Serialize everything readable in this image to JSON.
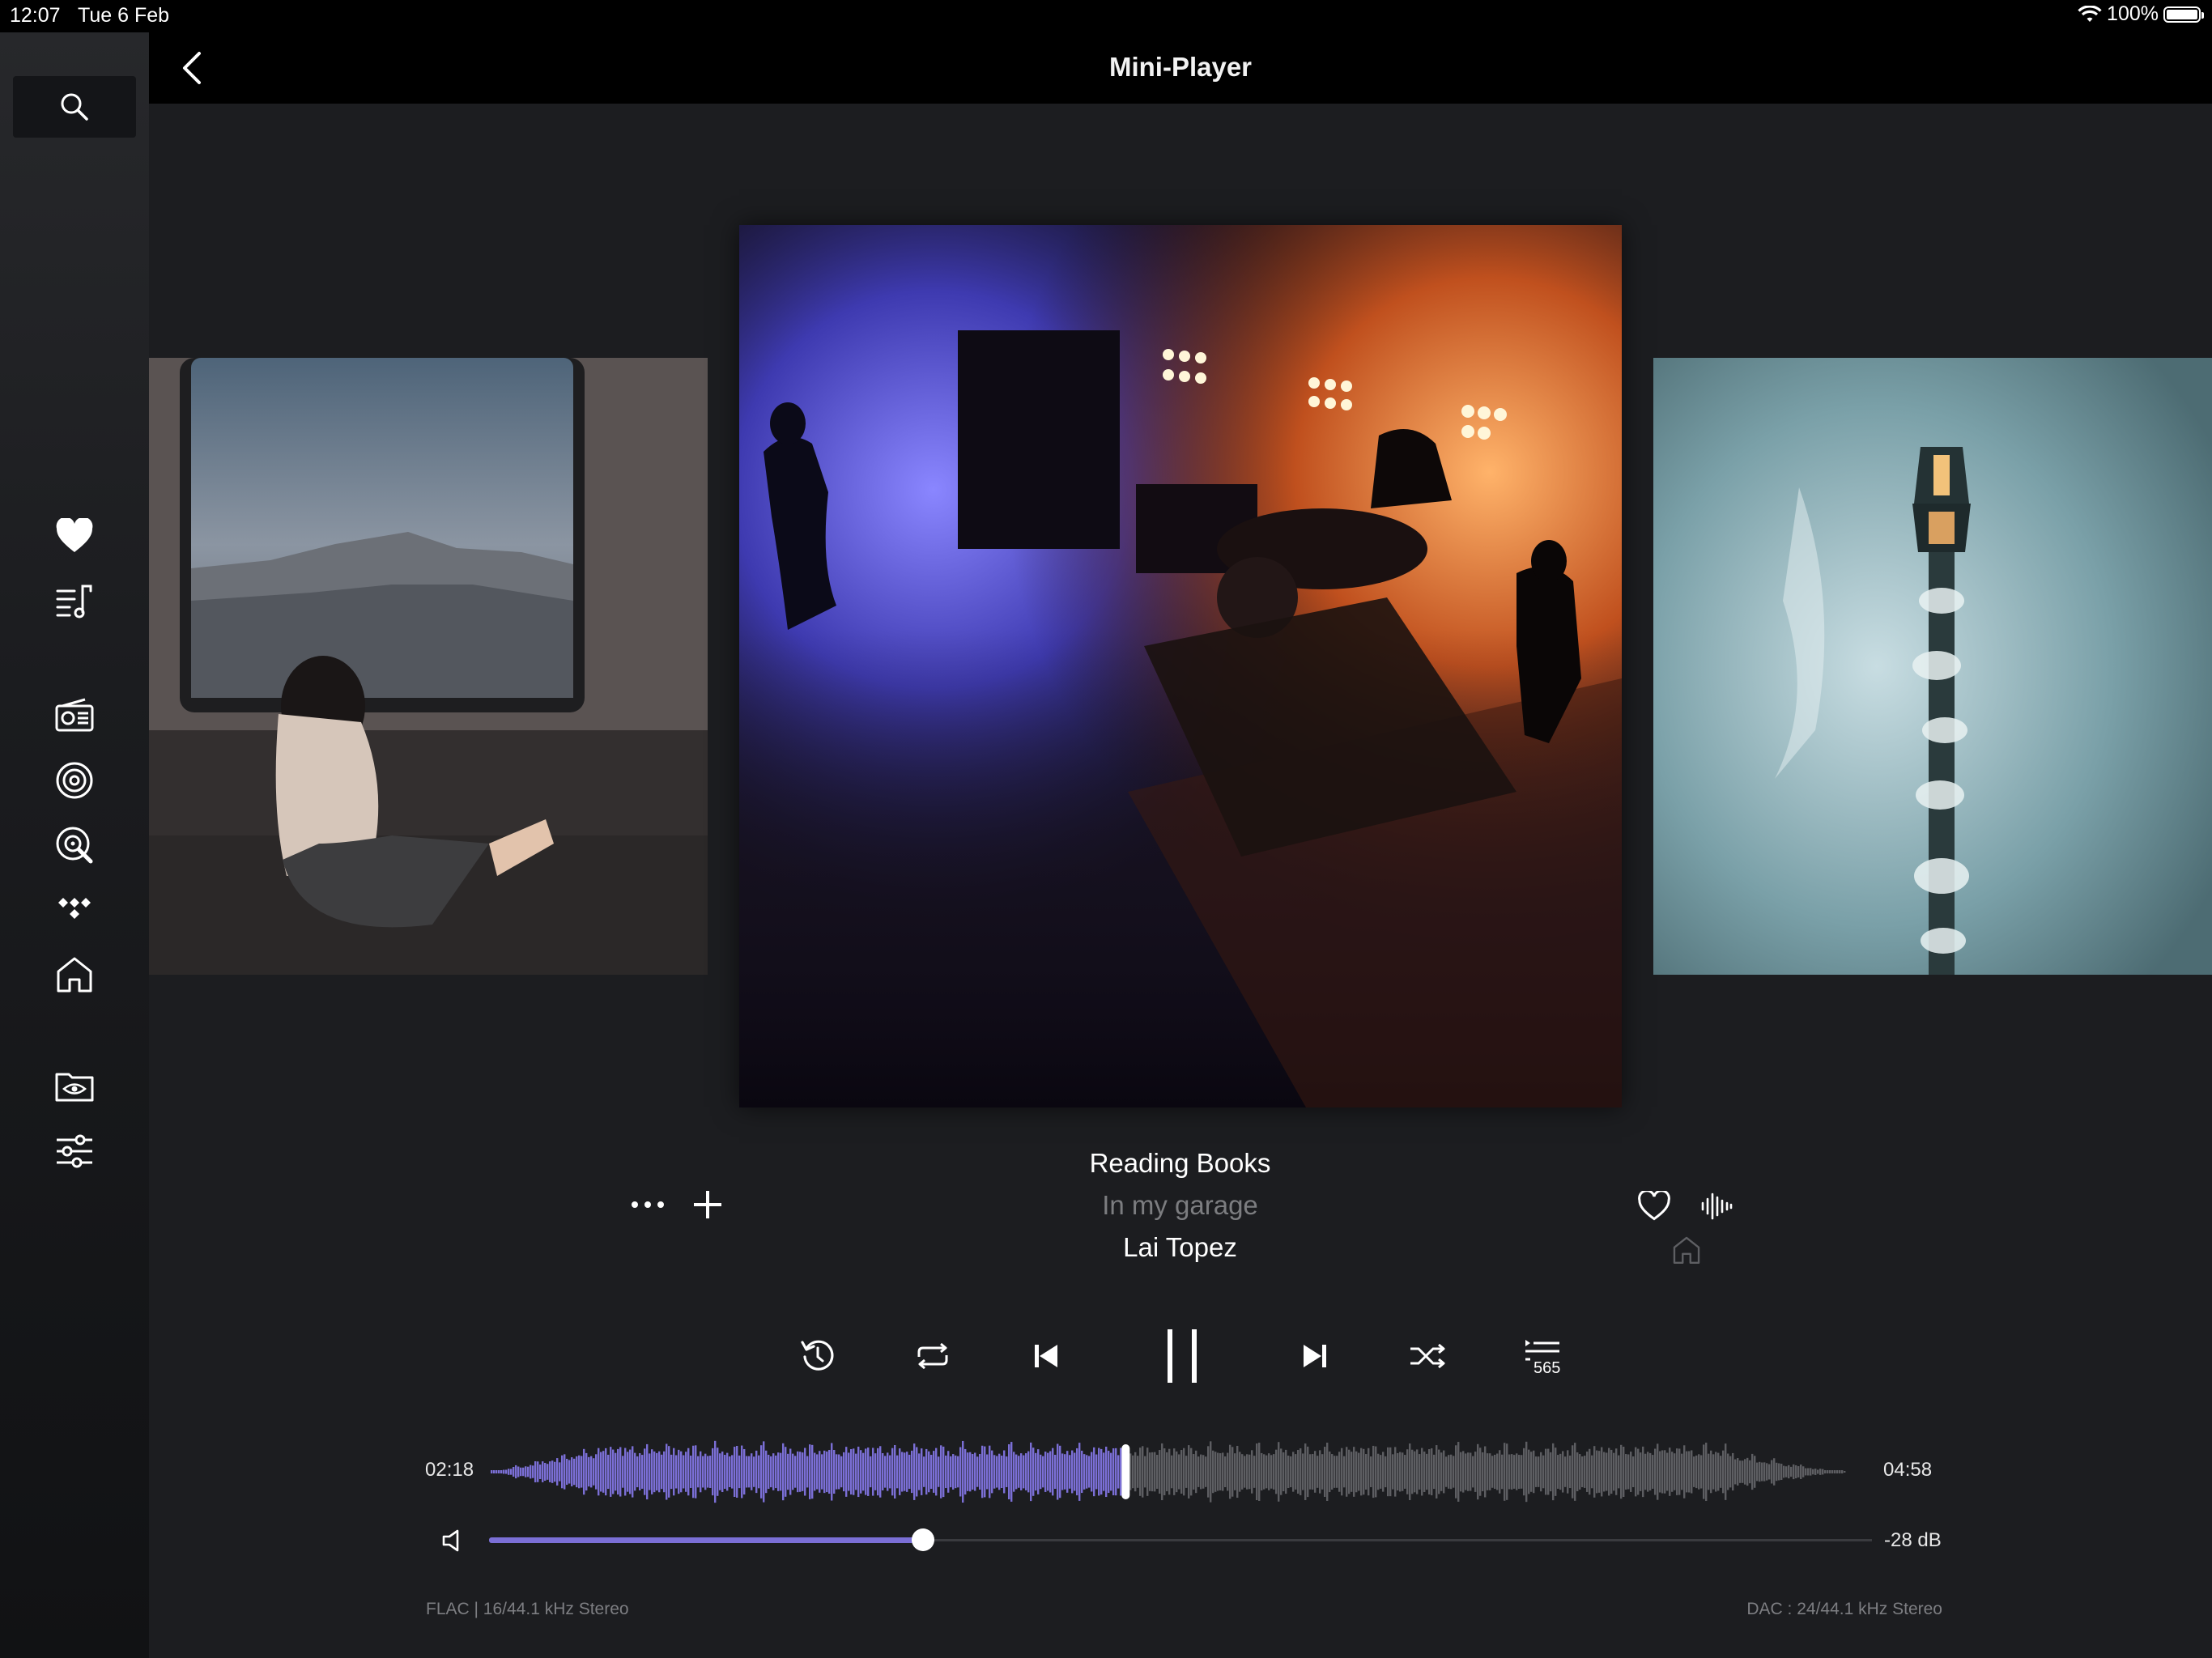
{
  "status_bar": {
    "time": "12:07",
    "date": "Tue 6 Feb",
    "battery": "100%"
  },
  "header": {
    "title": "Mini-Player",
    "back_icon": "chevron-left-icon"
  },
  "sidebar": {
    "search_icon": "search-icon",
    "items": [
      {
        "name": "favorites",
        "icon": "heart-icon"
      },
      {
        "name": "playlists",
        "icon": "playlist-icon"
      },
      {
        "name": "radio",
        "icon": "radio-icon"
      },
      {
        "name": "qobuz",
        "icon": "target-icon"
      },
      {
        "name": "streaming",
        "icon": "disc-search-icon"
      },
      {
        "name": "tidal",
        "icon": "tidal-icon"
      },
      {
        "name": "home",
        "icon": "home-icon"
      },
      {
        "name": "folders",
        "icon": "folder-eye-icon"
      },
      {
        "name": "settings",
        "icon": "sliders-icon"
      }
    ]
  },
  "track": {
    "title": "Reading Books",
    "album": "In my garage",
    "artist": "Lai Topez"
  },
  "controls": {
    "queue_count": "565",
    "is_playing": true
  },
  "progress": {
    "elapsed": "02:18",
    "total": "04:58",
    "fraction": 0.463
  },
  "volume": {
    "label": "-28 dB",
    "fraction": 0.314
  },
  "footer": {
    "format": "FLAC | 16/44.1 kHz Stereo",
    "dac": "DAC : 24/44.1 kHz Stereo"
  },
  "colors": {
    "accent": "#7b6fd6",
    "background": "#1c1d20",
    "waveform_rest": "#5d5e62"
  }
}
